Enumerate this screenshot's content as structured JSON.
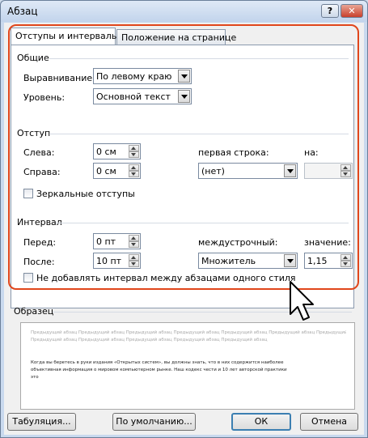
{
  "window": {
    "title": "Абзац",
    "help_label": "?",
    "close_label": "✕"
  },
  "tabs": [
    {
      "label": "Отступы и интервалы",
      "active": true
    },
    {
      "label": "Положение на странице",
      "active": false
    }
  ],
  "general": {
    "heading": "Общие",
    "alignment_label": "Выравнивание:",
    "alignment_value": "По левому краю",
    "level_label": "Уровень:",
    "level_value": "Основной текст"
  },
  "indent": {
    "heading": "Отступ",
    "left_label": "Слева:",
    "left_value": "0 см",
    "right_label": "Справа:",
    "right_value": "0 см",
    "first_line_label": "первая строка:",
    "first_line_value": "(нет)",
    "by_label": "на:",
    "by_value": "",
    "mirror_label": "Зеркальные отступы",
    "mirror_checked": false
  },
  "spacing": {
    "heading": "Интервал",
    "before_label": "Перед:",
    "before_value": "0 пт",
    "after_label": "После:",
    "after_value": "10 пт",
    "line_spacing_label": "междустрочный:",
    "line_spacing_value": "Множитель",
    "at_label": "значение:",
    "at_value": "1,15",
    "dont_add_label": "Не добавлять интервал между абзацами одного стиля",
    "dont_add_checked": false
  },
  "preview": {
    "heading": "Образец",
    "prev_lines": [
      "Предыдущий абзац Предыдущий абзац Предыдущий абзац Предыдущий абзац Предыдущий абзац Предыдущий абзац Предыдущий абзац",
      "Предыдущий абзац Предыдущий абзац Предыдущий абзац Предыдущий абзац Предыдущий абзац"
    ],
    "sample_lines": [
      "Когда вы беретесь в руки издания «Открытых систем», вы должны знать, что в них содержится наиболее",
      "объективная информация о мировом компьютерном рынке. Наш кодекс чести и 10 лет авторской практики",
      "это"
    ]
  },
  "buttons": {
    "tabs_label": "Табуляция...",
    "default_label": "По умолчанию...",
    "ok_label": "ОК",
    "cancel_label": "Отмена"
  },
  "colors": {
    "highlight": "#e0461c",
    "title_bg": "#c9d9ee"
  }
}
